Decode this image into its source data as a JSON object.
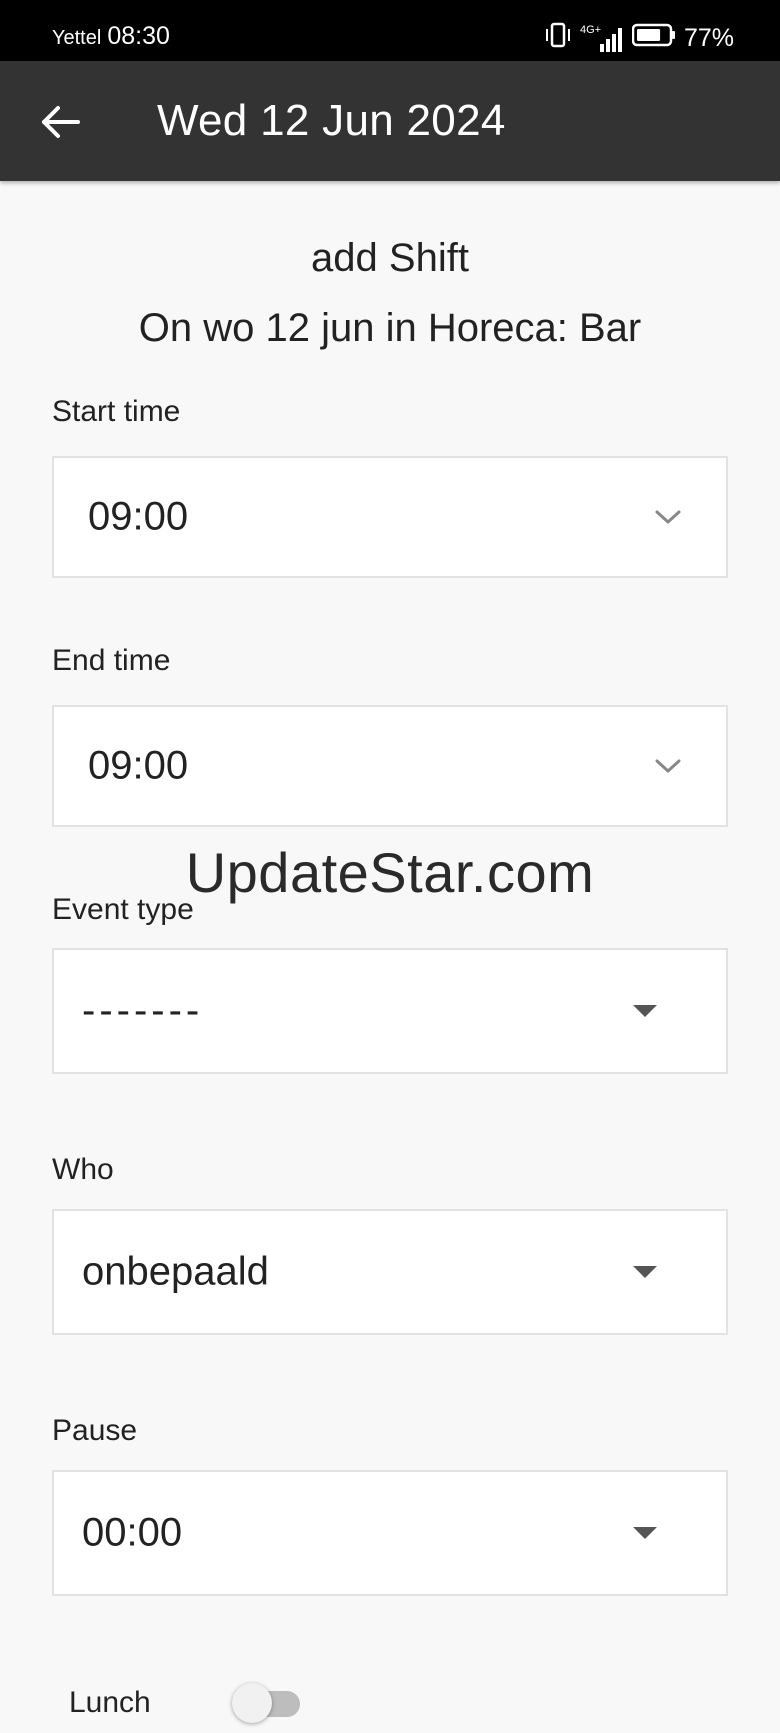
{
  "status_bar": {
    "carrier": "Yettel",
    "time": "08:30",
    "network": "4G+",
    "battery": "77%",
    "battery_level": 0.77,
    "icons": [
      "vibrate-icon",
      "signal-icon",
      "battery-icon"
    ]
  },
  "app_bar": {
    "back_icon": "arrow-left-icon",
    "title": "Wed 12 Jun 2024"
  },
  "form": {
    "heading": "add Shift",
    "subheading": "On wo 12 jun in Horeca: Bar",
    "start_time": {
      "label": "Start time",
      "value": "09:00"
    },
    "end_time": {
      "label": "End time",
      "value": "09:00"
    },
    "event_type": {
      "label": "Event type",
      "value": "-------"
    },
    "who": {
      "label": "Who",
      "value": "onbepaald"
    },
    "pause": {
      "label": "Pause",
      "value": "00:00"
    },
    "lunch": {
      "label": "Lunch",
      "enabled": false
    }
  },
  "watermark": "UpdateStar.com",
  "colors": {
    "app_bar_bg": "#333333",
    "page_bg": "#f8f8f8",
    "field_border": "#e2e2e2"
  }
}
